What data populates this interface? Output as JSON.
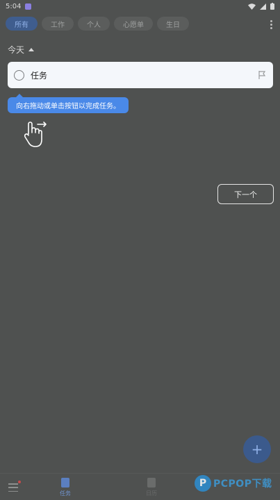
{
  "status_bar": {
    "time": "5:04"
  },
  "tabs": [
    {
      "label": "所有"
    },
    {
      "label": "工作"
    },
    {
      "label": "个人"
    },
    {
      "label": "心愿单"
    },
    {
      "label": "生日"
    }
  ],
  "section": {
    "title": "今天"
  },
  "task": {
    "title": "任务"
  },
  "tooltip": {
    "text": "向右拖动或单击按钮以完成任务。"
  },
  "next_button": {
    "label": "下一个"
  },
  "fab": {
    "label": "+"
  },
  "bottom_nav": {
    "tasks_label": "任务",
    "calendar_label": "日历"
  },
  "watermark": {
    "logo": "P",
    "text": "PCPOP下载"
  },
  "colors": {
    "accent": "#4a89e8",
    "background": "#4f5150",
    "card": "#f4f7fb"
  }
}
